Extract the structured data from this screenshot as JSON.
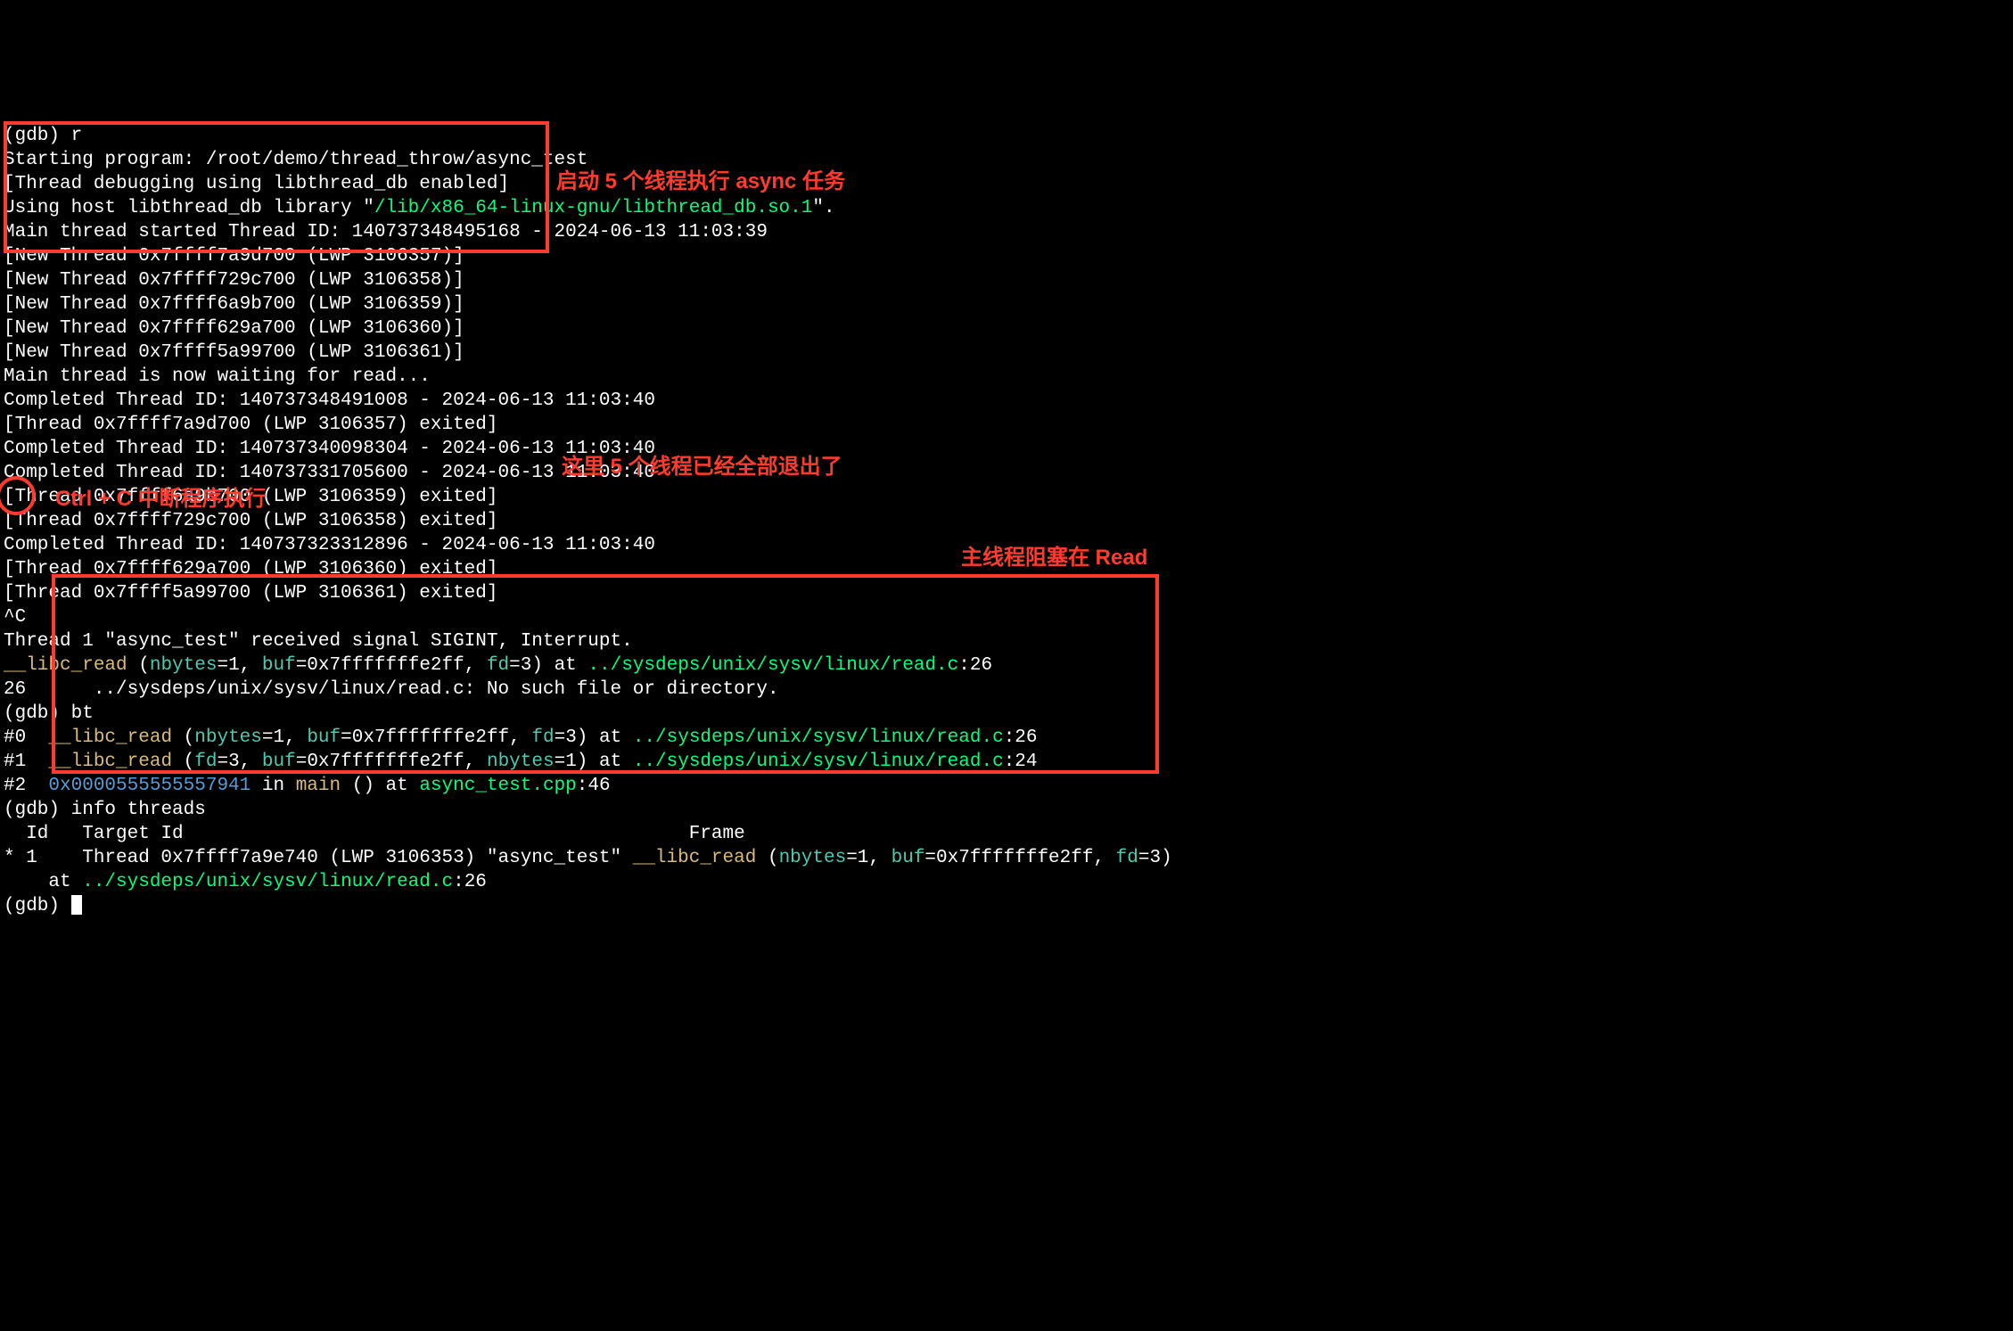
{
  "l1_prompt": "(gdb) ",
  "l1_cmd": "r",
  "l2": "Starting program: /root/demo/thread_throw/async_test",
  "l3": "[Thread debugging using libthread_db enabled]",
  "l4a": "Using host libthread_db library \"",
  "l4b": "/lib/x86_64-linux-gnu/libthread_db.so.1",
  "l4c": "\".",
  "l5": "Main thread started Thread ID: 140737348495168 - 2024-06-13 11:03:39",
  "nt1": "[New Thread 0x7ffff7a9d700 (LWP 3106357)]",
  "nt2": "[New Thread 0x7ffff729c700 (LWP 3106358)]",
  "nt3": "[New Thread 0x7ffff6a9b700 (LWP 3106359)]",
  "nt4": "[New Thread 0x7ffff629a700 (LWP 3106360)]",
  "nt5": "[New Thread 0x7ffff5a99700 (LWP 3106361)]",
  "w1": "Main thread is now waiting for read...",
  "c1": "Completed Thread ID: 140737348491008 - 2024-06-13 11:03:40",
  "e1": "[Thread 0x7ffff7a9d700 (LWP 3106357) exited]",
  "c2": "Completed Thread ID: 140737340098304 - 2024-06-13 11:03:40",
  "c3": "Completed Thread ID: 140737331705600 - 2024-06-13 11:03:40",
  "e2": "[Thread 0x7ffff6a9b700 (LWP 3106359) exited]",
  "e3": "[Thread 0x7ffff729c700 (LWP 3106358) exited]",
  "c4": "Completed Thread ID: 140737323312896 - 2024-06-13 11:03:40",
  "e4": "[Thread 0x7ffff629a700 (LWP 3106360) exited]",
  "e5": "[Thread 0x7ffff5a99700 (LWP 3106361) exited]",
  "sigc": "^C",
  "sig1": "Thread 1 \"async_test\" received signal SIGINT, Interrupt.",
  "rd_fn": "__libc_read",
  "rd_p1": " (",
  "rd_nb": "nbytes",
  "rd_eq1": "=1, ",
  "rd_buf": "buf",
  "rd_eq2": "=0x7fffffffe2ff, ",
  "rd_fd": "fd",
  "rd_eq3": "=3) at ",
  "rd_path": "../sysdeps/unix/sysv/linux/read.c",
  "rd_ln": ":26",
  "err_line": "26      ../sysdeps/unix/sysv/linux/read.c: No such file or directory.",
  "p2_prompt": "(gdb) ",
  "p2_cmd": "bt",
  "f0_a": "#0  ",
  "f0_fn": "__libc_read",
  "f0_p": " (",
  "f0_nb": "nbytes",
  "f0_e1": "=1, ",
  "f0_buf": "buf",
  "f0_e2": "=0x7fffffffe2ff, ",
  "f0_fd": "fd",
  "f0_e3": "=3) at ",
  "f0_path": "../sysdeps/unix/sysv/linux/read.c",
  "f0_ln": ":26",
  "f1_a": "#1  ",
  "f1_fn": "__libc_read",
  "f1_p": " (",
  "f1_fd": "fd",
  "f1_e1": "=3, ",
  "f1_buf": "buf",
  "f1_e2": "=0x7fffffffe2ff, ",
  "f1_nb": "nbytes",
  "f1_e3": "=1) at ",
  "f1_path": "../sysdeps/unix/sysv/linux/read.c",
  "f1_ln": ":24",
  "f2_a": "#2  ",
  "f2_addr": "0x0000555555557941",
  "f2_in": " in ",
  "f2_fn": "main",
  "f2_p": " () at ",
  "f2_path": "async_test.cpp",
  "f2_ln": ":46",
  "p3_prompt": "(gdb) ",
  "p3_cmd": "info threads",
  "th_hdr": "  Id   Target Id                                             Frame",
  "th_a": "* 1    Thread 0x7ffff7a9e740 (LWP 3106353) \"async_test\" ",
  "th_fn": "__libc_read",
  "th_p": " (",
  "th_nb": "nbytes",
  "th_e1": "=1, ",
  "th_buf": "buf",
  "th_e2": "=0x7fffffffe2ff, ",
  "th_fd": "fd",
  "th_e3": "=3)",
  "th_b": "    at ",
  "th_path": "../sysdeps/unix/sysv/linux/read.c",
  "th_ln": ":26",
  "p4_prompt": "(gdb) ",
  "anno1": "启动 5 个线程执行 async 任务",
  "anno2": "这里 5 个线程已经全部退出了",
  "anno3": "Ctrl + C 中断程序执行",
  "anno4": "主线程阻塞在 Read"
}
